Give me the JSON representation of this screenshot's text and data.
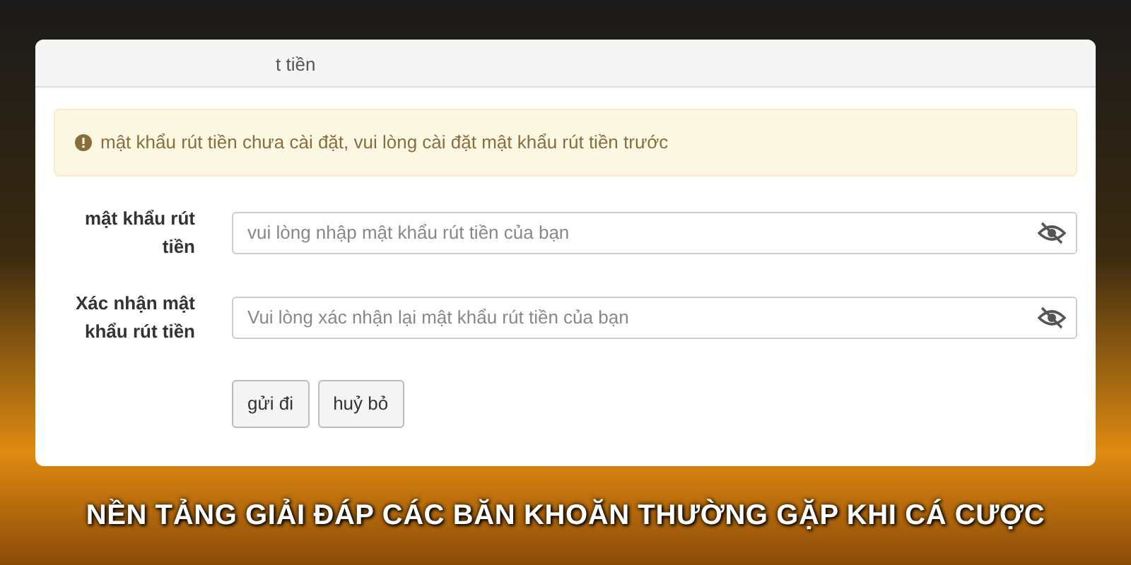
{
  "panel": {
    "header": "t tiền"
  },
  "alert": {
    "text": "mật khẩu rút tiền chưa cài đặt, vui lòng cài đặt mật khẩu rút tiền trước"
  },
  "fields": [
    {
      "label": "mật khẩu rút tiền",
      "placeholder": "vui lòng nhập mật khẩu rút tiền của bạn"
    },
    {
      "label": "Xác nhận mật khẩu rút tiền",
      "placeholder": "Vui lòng xác nhận lại mật khẩu rút tiền của bạn"
    }
  ],
  "buttons": [
    "gửi đi",
    "huỷ bỏ"
  ],
  "caption": "NỀN TẢNG GIẢI ĐÁP CÁC BĂN KHOĂN THƯỜNG GẶP KHI CÁ CƯỢC"
}
